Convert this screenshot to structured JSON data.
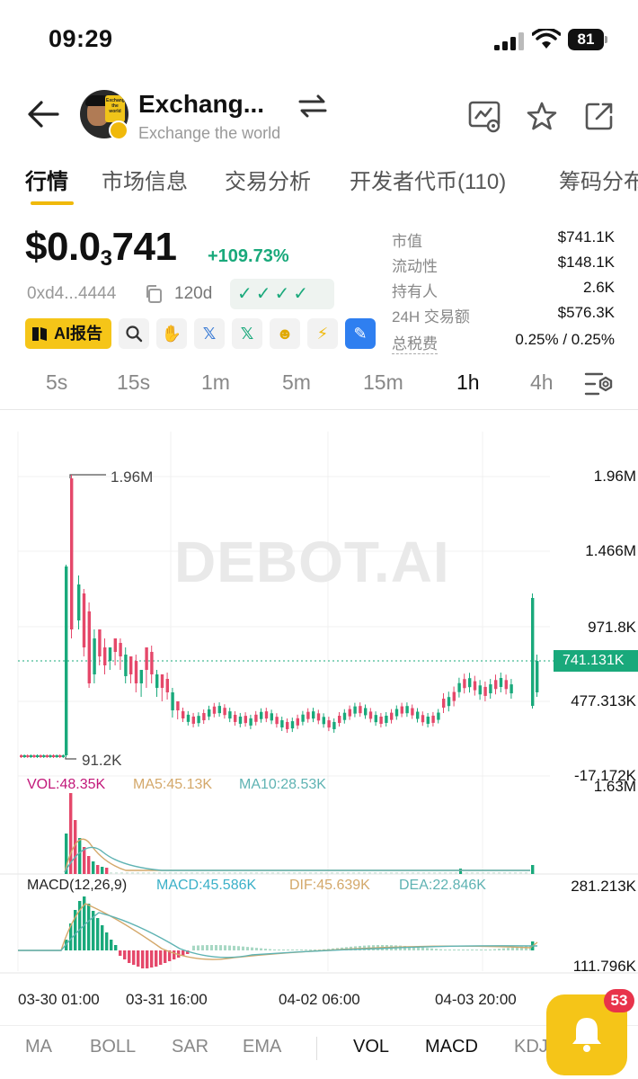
{
  "status_bar": {
    "time": "09:29",
    "battery": "81"
  },
  "header": {
    "token_name": "Exchang...",
    "token_subtitle": "Exchange the world",
    "avatar_sign_text": "Exchange the world"
  },
  "tabs": [
    "行情",
    "市场信息",
    "交易分析",
    "开发者代币(110)",
    "筹码分布"
  ],
  "price": {
    "prefix": "$0.0",
    "zeros": "3",
    "digits": "741",
    "change": "+109.73%"
  },
  "token_meta": {
    "address": "0xd4...4444",
    "age": "120d",
    "checks": "✓✓✓✓"
  },
  "actions": {
    "ai_report": "AI报告"
  },
  "stats": [
    {
      "label": "市值",
      "value": "$741.1K"
    },
    {
      "label": "流动性",
      "value": "$148.1K"
    },
    {
      "label": "持有人",
      "value": "2.6K"
    },
    {
      "label": "24H 交易额",
      "value": "$576.3K"
    },
    {
      "label": "总税费",
      "value": "0.25% / 0.25%"
    }
  ],
  "timeframes": [
    "5s",
    "15s",
    "1m",
    "5m",
    "15m",
    "1h",
    "4h"
  ],
  "active_timeframe": "1h",
  "chart_ui": {
    "watermark": "DEBOT.AI",
    "high_label": "1.96M",
    "low_label": "91.2K",
    "last_price_tag": "741.131K",
    "price_axis": [
      "1.96M",
      "1.466M",
      "971.8K",
      "477.313K",
      "-17.172K"
    ],
    "vol_axis": "1.63M",
    "macd_axis": [
      "281.213K",
      "111.796K"
    ],
    "vol_legend": {
      "vol": "VOL:48.35K",
      "ma5": "MA5:45.13K",
      "ma10": "MA10:28.53K"
    },
    "macd_legend": {
      "title": "MACD(12,26,9)",
      "macd": "MACD:45.586K",
      "dif": "DIF:45.639K",
      "dea": "DEA:22.846K"
    },
    "time_labels": [
      "03-30 01:00",
      "03-31 16:00",
      "04-02 06:00",
      "04-03 20:00"
    ]
  },
  "colors": {
    "up": "#19a97b",
    "down": "#e5486a",
    "accent": "#f5c518",
    "ma5": "#d4a86a",
    "ma10": "#5fb3b3"
  },
  "chart_data": {
    "type": "candlestick",
    "x_labels": [
      "03-30 01:00",
      "03-31 16:00",
      "04-02 06:00",
      "04-03 20:00"
    ],
    "price_range": [
      -17172,
      1960000
    ],
    "last_price": 741131,
    "high": 1960000,
    "low": 91200,
    "volume": {
      "vol": 48350,
      "ma5": 45130,
      "ma10": 28530,
      "max": 1630000
    },
    "macd": {
      "params": [
        12,
        26,
        9
      ],
      "macd": 45586,
      "dif": 45639,
      "dea": 22846,
      "range": [
        111796,
        281213
      ]
    }
  },
  "bottom_indicators": [
    "MA",
    "BOLL",
    "SAR",
    "EMA",
    "VOL",
    "MACD",
    "KDJ"
  ],
  "active_indicators": [
    "VOL",
    "MACD"
  ],
  "notifications": {
    "count": "53"
  }
}
